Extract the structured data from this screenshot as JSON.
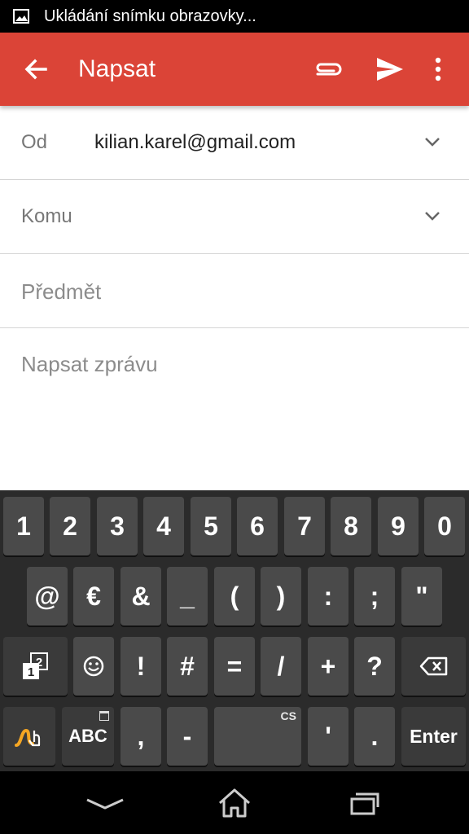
{
  "status_bar": {
    "text": "Ukládání snímku obrazovky...",
    "icon": "image-icon"
  },
  "app_bar": {
    "title": "Napsat",
    "color": "#db4437",
    "actions": [
      "back-arrow-icon",
      "attach-icon",
      "send-icon",
      "more-vert-icon"
    ]
  },
  "compose": {
    "from_label": "Od",
    "from_value": "kilian.karel@gmail.com",
    "to_label": "Komu",
    "subject_placeholder": "Předmět",
    "body_placeholder": "Napsat zprávu"
  },
  "keyboard": {
    "row1": [
      "1",
      "2",
      "3",
      "4",
      "5",
      "6",
      "7",
      "8",
      "9",
      "0"
    ],
    "row2": [
      "@",
      "€",
      "&",
      "_",
      "(",
      ")",
      ":",
      ";",
      "\""
    ],
    "row3": [
      "!",
      "#",
      "=",
      "/",
      "+",
      "?"
    ],
    "row3_left_icon": "number-page-icon",
    "row3_smiley_icon": "smiley-icon",
    "backspace_icon": "backspace-icon",
    "swype_icon": "swype-icon",
    "abc_label": "ABC",
    "comma": ",",
    "dash": "-",
    "space_hint": "CS",
    "apostrophe": "'",
    "period": ".",
    "enter_label": "Enter"
  },
  "nav_bar": {
    "icons": [
      "back-down-icon",
      "home-icon",
      "recents-icon"
    ]
  }
}
